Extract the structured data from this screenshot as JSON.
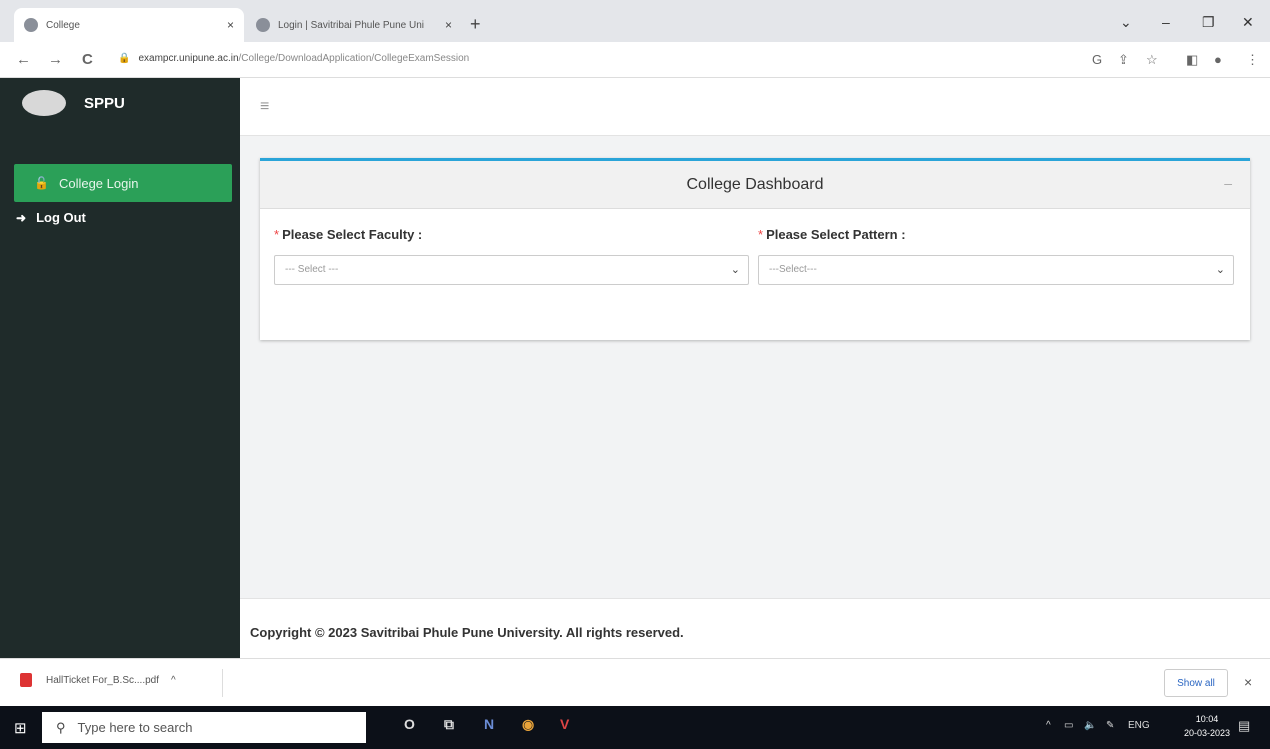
{
  "browser": {
    "tabs": [
      {
        "title": "College",
        "close": "×"
      },
      {
        "title": "Login | Savitribai Phule Pune Uni",
        "close": "×"
      }
    ],
    "new_tab": "+",
    "url_host": "exampcr.unipune.ac.in",
    "url_path": "/College/DownloadApplication/CollegeExamSession",
    "window_controls": {
      "chevron": "⌄",
      "minimize": "–",
      "restore": "❐",
      "close": "✕"
    },
    "nav": {
      "back": "←",
      "forward": "→",
      "reload": "C"
    }
  },
  "sidebar": {
    "brand": "SPPU",
    "items": [
      {
        "label": "College Login",
        "icon": "lock-icon",
        "glyph": "🔓"
      },
      {
        "label": "Log Out",
        "icon": "logout-icon",
        "glyph": "➜"
      }
    ]
  },
  "main": {
    "hamburger": "≡",
    "card": {
      "title": "College Dashboard",
      "collapse": "–",
      "faculty": {
        "required": "*",
        "label": "Please Select Faculty :",
        "selected": "--- Select ---"
      },
      "pattern": {
        "required": "*",
        "label": "Please Select Pattern :",
        "selected": "---Select---"
      }
    },
    "footer": "Copyright © 2023 Savitribai Phule Pune University. All rights reserved."
  },
  "downloads": {
    "file": "HallTicket For_B.Sc....pdf",
    "chevron": "^",
    "show_all": "Show all",
    "close": "×"
  },
  "taskbar": {
    "search_placeholder": "Type here to search",
    "tray_lang": "ENG",
    "time": "10:04",
    "date": "20-03-2023"
  },
  "colors": {
    "sidebar": "#1f2b2a",
    "active_item": "#2ba058",
    "card_accent": "#2aa4d8"
  }
}
